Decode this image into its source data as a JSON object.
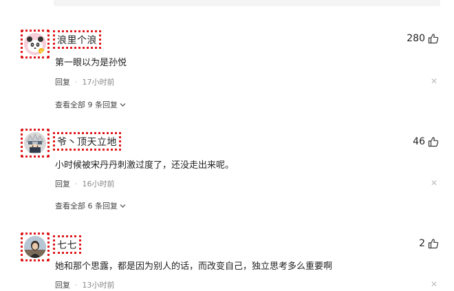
{
  "comments": [
    {
      "username": "浪里个浪",
      "likes": "280",
      "text": "第一眼以为是孙悦",
      "reply_label": "回复",
      "time": "17小时前",
      "view_replies": "查看全部 9 条回复",
      "avatar": "panda-avatar"
    },
    {
      "username": "爷丶顶天立地",
      "likes": "46",
      "text": "小时候被宋丹丹刺激过度了，还没走出来呢。",
      "reply_label": "回复",
      "time": "16小时前",
      "view_replies": "查看全部 6 条回复",
      "avatar": "ninja-avatar"
    },
    {
      "username": "七七",
      "likes": "2",
      "text": "她和那个思露，都是因为别人的话，而改变自己，独立思考多么重要啊",
      "reply_label": "回复",
      "time": "13小时前",
      "avatar": "photo-avatar"
    }
  ],
  "colors": {
    "highlight": "#e0171b",
    "text": "#222222",
    "meta": "#888888"
  }
}
